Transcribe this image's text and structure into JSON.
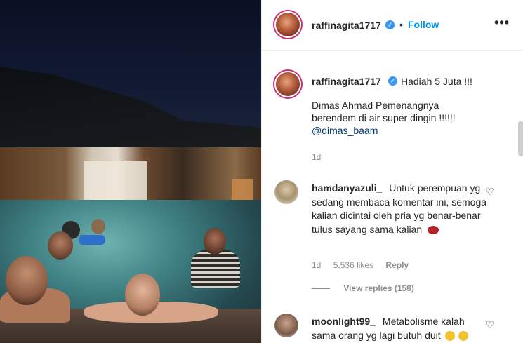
{
  "post": {
    "username": "raffinagita1717",
    "follow_label": "Follow",
    "separator": "•",
    "more_label": "•••"
  },
  "caption": {
    "username": "raffinagita1717",
    "headline": "Hadiah 5 Juta !!!",
    "line1": "Dimas Ahmad Pemenangnya",
    "line2": "berendem di air super dingin !!!!!!",
    "mention": "@dimas_baam",
    "time": "1d"
  },
  "comments": [
    {
      "username": "hamdanyazuli_",
      "text": "Untuk perempuan yg sedang membaca komentar ini, semoga kalian dicintai oleh pria yg benar-benar tulus sayang sama kalian",
      "time": "1d",
      "likes": "5,536 likes",
      "reply_label": "Reply",
      "view_replies": "View replies (158)"
    },
    {
      "username": "moonlight99_",
      "text": "Metabolisme kalah sama orang yg lagi butuh duit"
    }
  ],
  "colors": {
    "accent": "#0095f6",
    "verified": "#3897f0",
    "muted": "#8e8e8e"
  },
  "icons": {
    "verified": "✓",
    "heart": "♡"
  }
}
